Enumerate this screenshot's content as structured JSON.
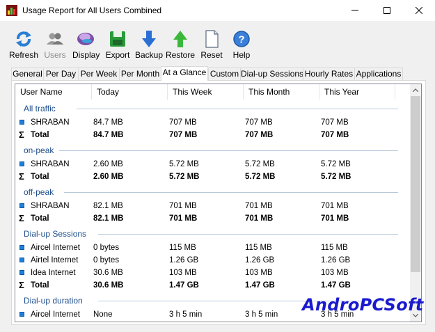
{
  "window": {
    "title": "Usage Report for All Users Combined"
  },
  "toolbar": {
    "buttons": [
      {
        "label": "Refresh",
        "icon": "refresh-icon",
        "enabled": true
      },
      {
        "label": "Users",
        "icon": "users-icon",
        "enabled": false
      },
      {
        "label": "Display",
        "icon": "display-icon",
        "enabled": true
      },
      {
        "label": "Export",
        "icon": "export-icon",
        "enabled": true
      },
      {
        "label": "Backup",
        "icon": "backup-icon",
        "enabled": true
      },
      {
        "label": "Restore",
        "icon": "restore-icon",
        "enabled": true
      },
      {
        "label": "Reset",
        "icon": "reset-icon",
        "enabled": true
      },
      {
        "label": "Help",
        "icon": "help-icon",
        "enabled": true
      }
    ]
  },
  "tabs": [
    "General",
    "Per Day",
    "Per Week",
    "Per Month",
    "At a Glance",
    "Custom",
    "Dial-up Sessions",
    "Hourly Rates",
    "Applications"
  ],
  "active_tab": "At a Glance",
  "columns": [
    "User Name",
    "Today",
    "This Week",
    "This Month",
    "This Year"
  ],
  "groups": [
    {
      "name": "All traffic",
      "rows": [
        {
          "kind": "user",
          "name": "SHRABAN",
          "today": "84.7 MB",
          "week": "707 MB",
          "month": "707 MB",
          "year": "707 MB"
        },
        {
          "kind": "total",
          "name": "Total",
          "today": "84.7 MB",
          "week": "707 MB",
          "month": "707 MB",
          "year": "707 MB"
        }
      ]
    },
    {
      "name": "on-peak",
      "rows": [
        {
          "kind": "user",
          "name": "SHRABAN",
          "today": "2.60 MB",
          "week": "5.72 MB",
          "month": "5.72 MB",
          "year": "5.72 MB"
        },
        {
          "kind": "total",
          "name": "Total",
          "today": "2.60 MB",
          "week": "5.72 MB",
          "month": "5.72 MB",
          "year": "5.72 MB"
        }
      ]
    },
    {
      "name": "off-peak",
      "rows": [
        {
          "kind": "user",
          "name": "SHRABAN",
          "today": "82.1 MB",
          "week": "701 MB",
          "month": "701 MB",
          "year": "701 MB"
        },
        {
          "kind": "total",
          "name": "Total",
          "today": "82.1 MB",
          "week": "701 MB",
          "month": "701 MB",
          "year": "701 MB"
        }
      ]
    },
    {
      "name": "Dial-up Sessions",
      "rows": [
        {
          "kind": "user",
          "name": "Aircel Internet",
          "today": "0 bytes",
          "week": "115 MB",
          "month": "115 MB",
          "year": "115 MB"
        },
        {
          "kind": "user",
          "name": "Airtel Internet",
          "today": "0 bytes",
          "week": "1.26 GB",
          "month": "1.26 GB",
          "year": "1.26 GB"
        },
        {
          "kind": "user",
          "name": "Idea Internet",
          "today": "30.6 MB",
          "week": "103 MB",
          "month": "103 MB",
          "year": "103 MB"
        },
        {
          "kind": "total",
          "name": "Total",
          "today": "30.6 MB",
          "week": "1.47 GB",
          "month": "1.47 GB",
          "year": "1.47 GB"
        }
      ]
    },
    {
      "name": "Dial-up duration",
      "rows": [
        {
          "kind": "user",
          "name": "Aircel Internet",
          "today": "None",
          "week": "3 h 5 min",
          "month": "3 h 5 min",
          "year": "3 h 5 min"
        }
      ]
    }
  ],
  "watermark": "AndroPCSoft",
  "colors": {
    "group_text": "#1e4e8c",
    "user_marker": "#1e7fd8",
    "watermark": "#1a1acd"
  }
}
